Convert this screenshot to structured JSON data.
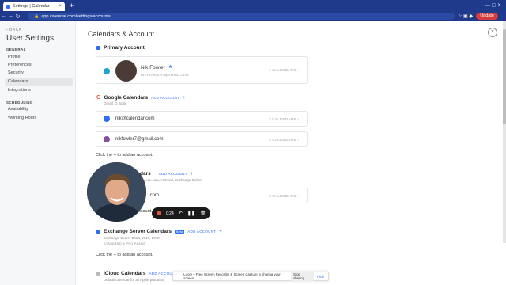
{
  "browser": {
    "tab_title": "Settings | Calendar",
    "new_tab": "+",
    "url": "app.calendar.com/settings/accounts",
    "update_label": "Update"
  },
  "sidebar": {
    "back_label": "‹ BACK",
    "title": "User Settings",
    "general_heading": "GENERAL",
    "general_items": [
      {
        "label": "Profile"
      },
      {
        "label": "Preferences"
      },
      {
        "label": "Security"
      },
      {
        "label": "Calendars"
      },
      {
        "label": "Integrations"
      }
    ],
    "active_item": "Calendars",
    "scheduling_heading": "SCHEDULING",
    "scheduling_items": [
      {
        "label": "Availability"
      },
      {
        "label": "Working Hours"
      }
    ]
  },
  "main": {
    "page_title": "Calendars & Account",
    "close_icon": "×",
    "primary": {
      "heading": "Primary Account",
      "name": "Nik Fowler",
      "email": "NIKFOWLER7@GMAIL.COM",
      "count": "1 CALENDARS ›"
    },
    "google": {
      "heading": "Google Calendars",
      "add_label": "ADD ACCOUNT",
      "sub": "Gmail, G Suite",
      "accounts": [
        {
          "email": "nik@calendar.com",
          "count": "3 CALENDARS ›",
          "color": "#2d6df6"
        },
        {
          "email": "nikfowler7@gmail.com",
          "count": "4 CALENDARS ›",
          "color": "#8a4f9e"
        }
      ],
      "hint": "Click the + to add an account."
    },
    "outlook": {
      "heading": "dars",
      "add_label": "ADD ACCOUNT",
      "sub": "Live.com, Hotmail, Exchange Online",
      "account_partial": ".com",
      "count": "3 CALENDARS ›",
      "hint_partial": "ccount."
    },
    "exchange": {
      "heading": "Exchange Server Calendars",
      "beta": "Beta",
      "add_label": "ADD ACCOUNT",
      "sub": "Exchange Server 2013, 2016, 2019",
      "tag": "STANDARD & PRO PLANS",
      "hint": "Click the + to add an account."
    },
    "icloud": {
      "heading": "iCloud Calendars",
      "add_label": "ADD ACCOUNT",
      "sub": "Default calendar for all Apple products"
    }
  },
  "loom": {
    "time": "0:24",
    "share_text": "Loom – Free Screen Recorder & Screen Capture is sharing your screen.",
    "stop_label": "Stop sharing",
    "hide_label": "Hide"
  }
}
